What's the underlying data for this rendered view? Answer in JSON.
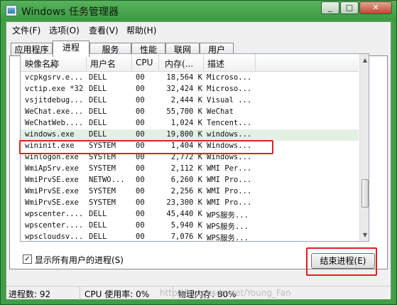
{
  "window": {
    "title": "Windows 任务管理器",
    "min": "_",
    "max": "□",
    "close": "✕"
  },
  "menu": [
    "文件(F)",
    "选项(O)",
    "查看(V)",
    "帮助(H)"
  ],
  "tabs": [
    "应用程序",
    "进程",
    "服务",
    "性能",
    "联网",
    "用户"
  ],
  "active_tab": "进程",
  "columns": [
    "映像名称",
    "用户名",
    "CPU",
    "内存(...",
    "描述"
  ],
  "rows": [
    {
      "name": "vcpkgsrv.e...",
      "user": "DELL",
      "cpu": "00",
      "mem": "18,564 K",
      "desc": "Microso..."
    },
    {
      "name": "vctip.exe *32",
      "user": "DELL",
      "cpu": "00",
      "mem": "32,424 K",
      "desc": "Microso..."
    },
    {
      "name": "vsjitdebug...",
      "user": "DELL",
      "cpu": "00",
      "mem": "2,444 K",
      "desc": "Visual ..."
    },
    {
      "name": "WeChat.exe...",
      "user": "DELL",
      "cpu": "00",
      "mem": "55,700 K",
      "desc": "WeChat"
    },
    {
      "name": "WeChatWeb....",
      "user": "DELL",
      "cpu": "00",
      "mem": "1,024 K",
      "desc": "Tencent..."
    },
    {
      "name": "windows.exe",
      "user": "DELL",
      "cpu": "00",
      "mem": "19,800 K",
      "desc": "windows..."
    },
    {
      "name": "wininit.exe",
      "user": "SYSTEM",
      "cpu": "00",
      "mem": "1,404 K",
      "desc": "Windows..."
    },
    {
      "name": "winlogon.exe",
      "user": "SYSTEM",
      "cpu": "00",
      "mem": "2,772 K",
      "desc": "Windows..."
    },
    {
      "name": "WmiApSrv.exe",
      "user": "SYSTEM",
      "cpu": "00",
      "mem": "2,112 K",
      "desc": "WMI Per..."
    },
    {
      "name": "WmiPrvSE.exe",
      "user": "NETWO...",
      "cpu": "00",
      "mem": "6,260 K",
      "desc": "WMI Pro..."
    },
    {
      "name": "WmiPrvSE.exe",
      "user": "SYSTEM",
      "cpu": "00",
      "mem": "2,256 K",
      "desc": "WMI Pro..."
    },
    {
      "name": "WmiPrvSE.exe",
      "user": "SYSTEM",
      "cpu": "00",
      "mem": "23,300 K",
      "desc": "WMI Pro..."
    },
    {
      "name": "wpscenter....",
      "user": "DELL",
      "cpu": "00",
      "mem": "45,440 K",
      "desc": "WPS服务..."
    },
    {
      "name": "wpscenter....",
      "user": "DELL",
      "cpu": "00",
      "mem": "5,940 K",
      "desc": "WPS服务..."
    },
    {
      "name": "wpscloudsv...",
      "user": "DELL",
      "cpu": "00",
      "mem": "7,076 K",
      "desc": "WPS服务..."
    }
  ],
  "selected_index": 5,
  "checkbox": {
    "label": "显示所有用户的进程(S)",
    "checked": "✓"
  },
  "end_button": "结束进程(E)",
  "status": {
    "processes": "进程数: 92",
    "cpu": "CPU 使用率: 0%",
    "memory": "物理内存: 80%"
  },
  "watermark": "http://blog.csdn.net/Young_Fan"
}
